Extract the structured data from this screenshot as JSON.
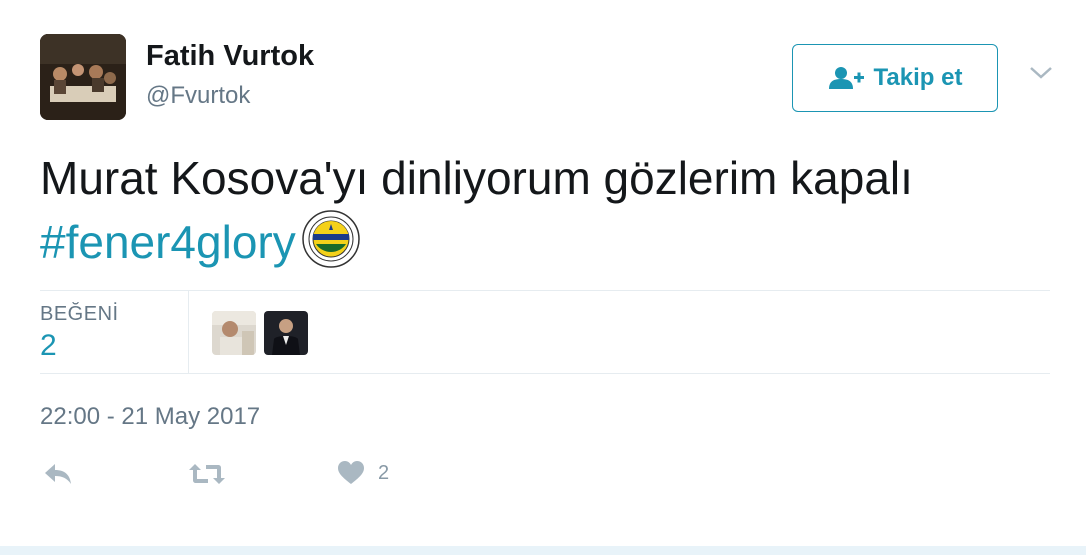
{
  "user": {
    "name": "Fatih Vurtok",
    "handle": "@Fvurtok",
    "avatar_icon": "profile-photo"
  },
  "follow_button": {
    "label": "Takip et",
    "icon": "follow-user-icon"
  },
  "menu": {
    "icon": "chevron-down-icon"
  },
  "tweet": {
    "text": "Murat Kosova'yı dinliyorum gözlerim kapalı",
    "hashtag": "#fener4glory",
    "emoji_icon": "fenerbahce-badge-icon"
  },
  "stats": {
    "likes_label": "BEĞENİ",
    "likes_count": "2",
    "liker_avatars": [
      "liker-avatar-1",
      "liker-avatar-2"
    ]
  },
  "timestamp": "22:00 - 21 May 2017",
  "actions": {
    "reply_icon": "reply-icon",
    "retweet_icon": "retweet-icon",
    "like_icon": "heart-icon",
    "like_count": "2"
  },
  "colors": {
    "accent": "#1b95b3",
    "text": "#14171a",
    "muted": "#657786",
    "action_icon": "#aab8c2",
    "divider": "#e6ecf0",
    "footer_band": "#e8f3f9"
  }
}
